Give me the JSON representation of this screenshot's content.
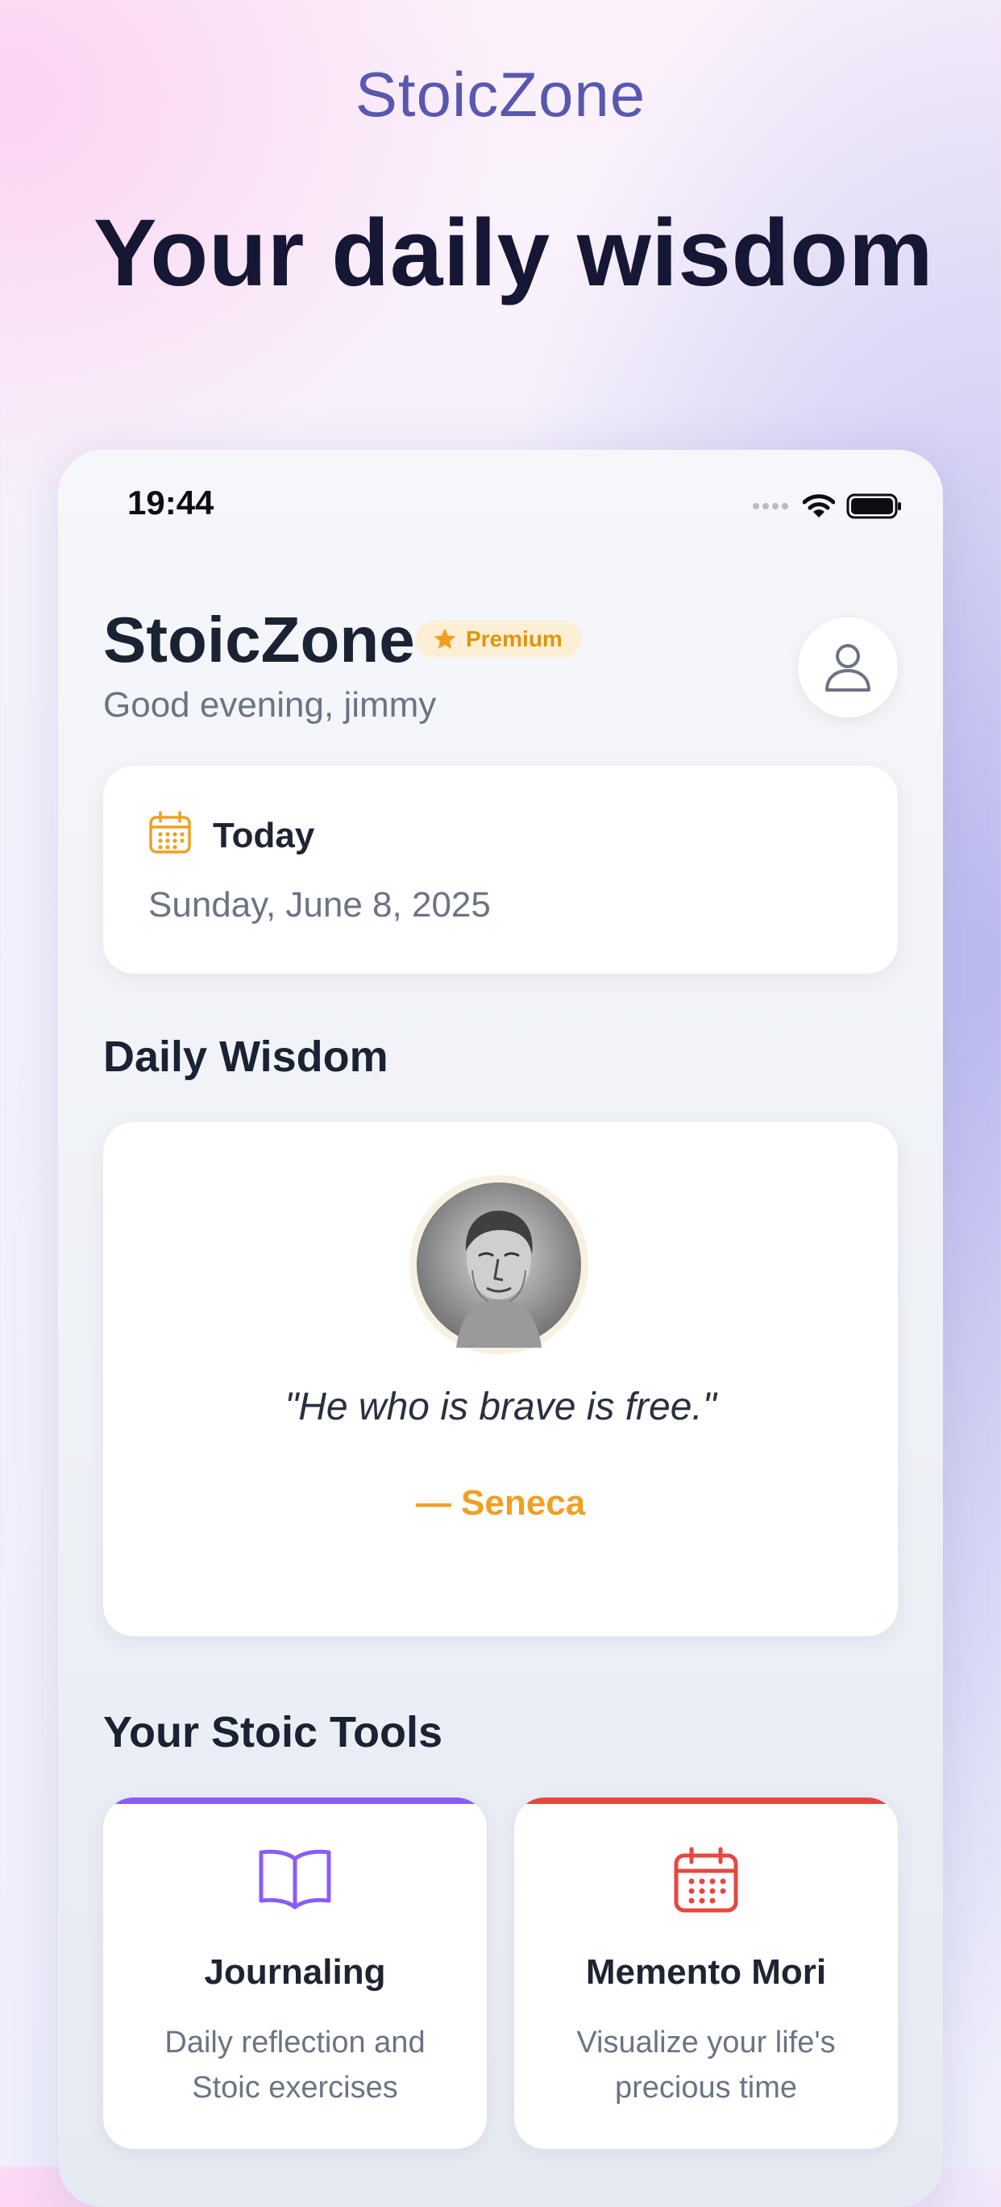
{
  "marketing": {
    "brand": "StoicZone",
    "headline": "Your daily wisdom"
  },
  "status_bar": {
    "time": "19:44"
  },
  "header": {
    "app_title": "StoicZone",
    "premium_badge": "Premium",
    "greeting": "Good evening, jimmy"
  },
  "today": {
    "label": "Today",
    "date": "Sunday, June 8, 2025"
  },
  "daily_wisdom": {
    "section_title": "Daily Wisdom",
    "quote": "\"He who is brave is free.\"",
    "author": "— Seneca"
  },
  "tools": {
    "section_title": "Your Stoic Tools",
    "items": [
      {
        "title": "Journaling",
        "description": "Daily reflection and Stoic exercises",
        "icon": "book-icon",
        "accent": "#8b5cf6"
      },
      {
        "title": "Memento Mori",
        "description": "Visualize your life's precious time",
        "icon": "calendar-icon",
        "accent": "#e5483f"
      }
    ]
  },
  "colors": {
    "brand_text": "#5858b0",
    "premium": "#f0a020",
    "journaling": "#8b5cf6",
    "memento_mori": "#e5483f"
  }
}
